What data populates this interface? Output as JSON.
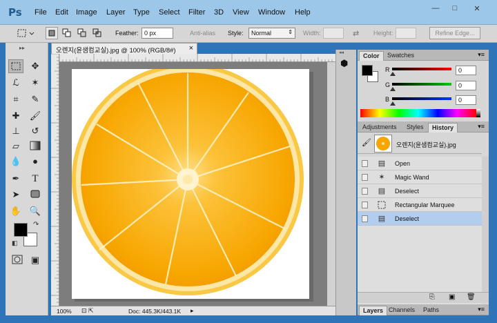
{
  "app": {
    "logo": "Ps"
  },
  "menu": [
    "File",
    "Edit",
    "Image",
    "Layer",
    "Type",
    "Select",
    "Filter",
    "3D",
    "View",
    "Window",
    "Help"
  ],
  "window_controls": {
    "minimize": "—",
    "maximize": "□",
    "close": "✕"
  },
  "options": {
    "feather_label": "Feather:",
    "feather_value": "0 px",
    "antialias_label": "Anti-alias",
    "style_label": "Style:",
    "style_value": "Normal",
    "width_label": "Width:",
    "height_label": "Height:",
    "refine_label": "Refine Edge..."
  },
  "document": {
    "tab_title": "오렌지(윤샘컴교실).jpg @ 100% (RGB/8#)",
    "close": "×",
    "zoom": "100%",
    "doc_info": "Doc: 445.3K/443.1K"
  },
  "color_panel": {
    "tabs": [
      "Color",
      "Swatches"
    ],
    "r_label": "R",
    "g_label": "G",
    "b_label": "B",
    "r_value": "0",
    "g_value": "0",
    "b_value": "0"
  },
  "history_panel": {
    "tabs": [
      "Adjustments",
      "Styles",
      "History"
    ],
    "snapshot_label": "오렌지(윤샘컴교실).jpg",
    "items": [
      {
        "label": "Open",
        "icon": "document-icon"
      },
      {
        "label": "Magic Wand",
        "icon": "magic-wand-icon"
      },
      {
        "label": "Deselect",
        "icon": "document-icon"
      },
      {
        "label": "Rectangular Marquee",
        "icon": "marquee-icon"
      },
      {
        "label": "Deselect",
        "icon": "document-icon"
      }
    ],
    "selected_index": 4
  },
  "layers_tabs": [
    "Layers",
    "Channels",
    "Paths"
  ],
  "colors": {
    "frame": "#2d74b8",
    "menubar": "#9cc7e9",
    "orange": "#f7a600",
    "selection": "#b3cdef"
  }
}
